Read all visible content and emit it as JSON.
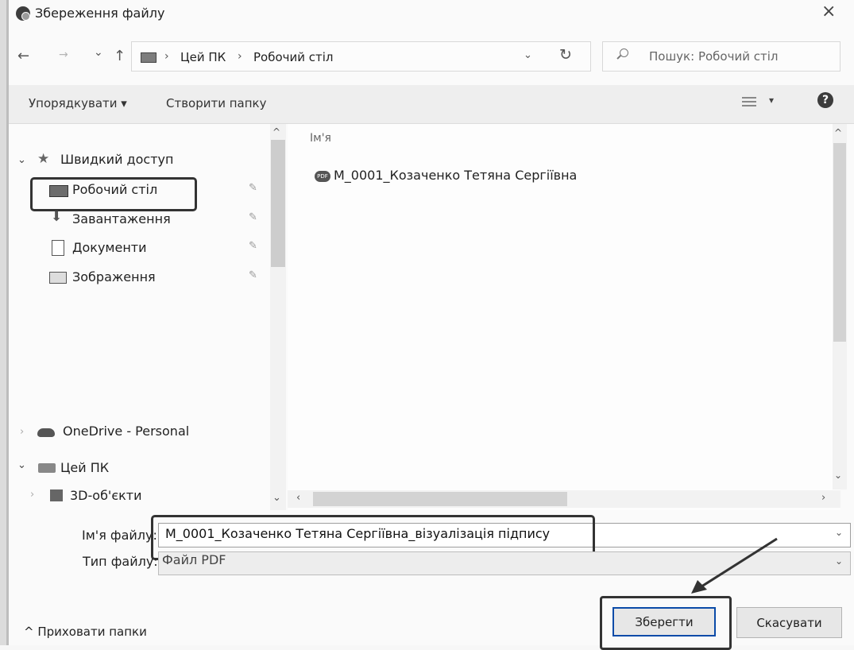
{
  "window": {
    "title": "Збереження файлу",
    "close": "×"
  },
  "nav": {
    "back": "←",
    "forward": "→",
    "recent": "⌄",
    "up": "↑",
    "breadcrumb": [
      "Цей ПК",
      "Робочий стіл"
    ],
    "breadcrumb_sep": "›",
    "dropdown": "⌄",
    "refresh": "↻"
  },
  "search": {
    "placeholder": "Пошук: Робочий стіл"
  },
  "toolbar": {
    "organize": "Упорядкувати ▾",
    "new_folder": "Створити папку",
    "view_dropdown": "▾",
    "help": "?"
  },
  "sidebar": {
    "quick_access": "Швидкий доступ",
    "items": [
      {
        "label": "Робочий стіл",
        "icon": "desktop-icon"
      },
      {
        "label": "Завантаження",
        "icon": "download-icon"
      },
      {
        "label": "Документи",
        "icon": "document-icon"
      },
      {
        "label": "Зображення",
        "icon": "picture-icon"
      }
    ],
    "onedrive": "OneDrive - Personal",
    "this_pc": "Цей ПК",
    "objects_3d": "3D-об'єкти"
  },
  "files": {
    "column_name": "Ім'я",
    "items": [
      {
        "name": "M_0001_Козаченко Тетяна Сергіївна",
        "icon": "file-icon"
      }
    ]
  },
  "form": {
    "filename_label": "Ім'я файлу:",
    "filename_value": "M_0001_Козаченко Тетяна Сергіївна_візуалізація підпису",
    "filetype_label": "Тип файлу:",
    "filetype_value": "Файл PDF"
  },
  "footer": {
    "hide_folders": "^  Приховати папки",
    "save": "Зберегти",
    "cancel": "Скасувати"
  },
  "colors": {
    "accent": "#0a4ba8",
    "highlight_border": "#333333"
  }
}
